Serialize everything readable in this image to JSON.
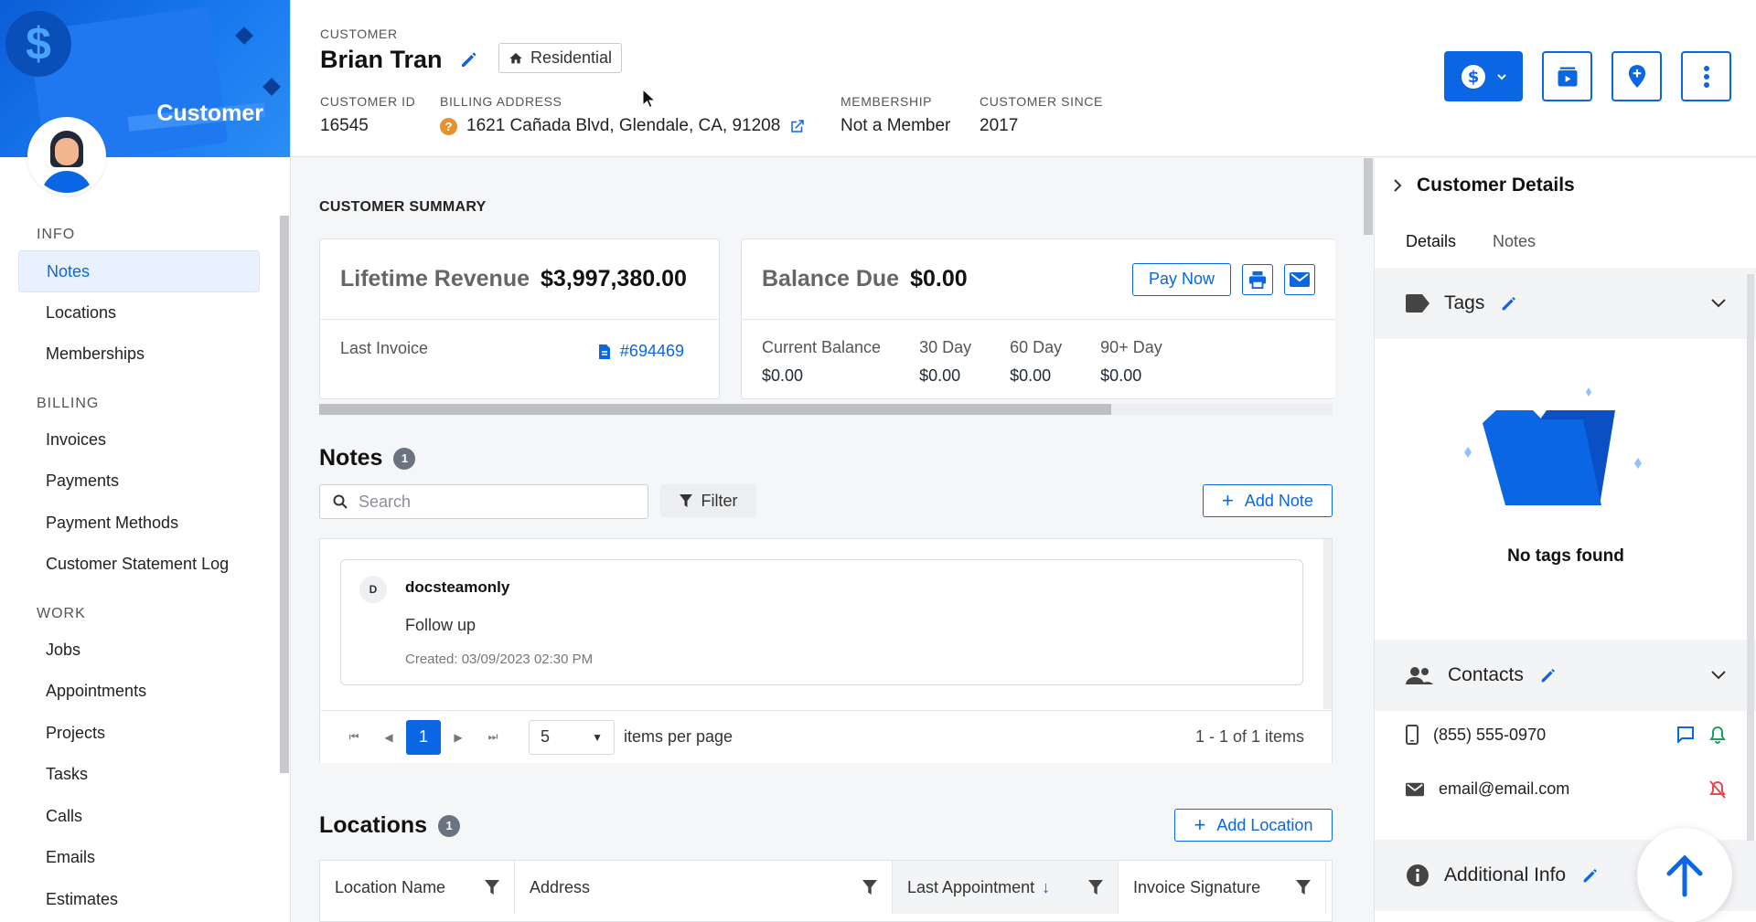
{
  "sidebar": {
    "banner_title": "Customer",
    "sections": [
      {
        "title": "INFO",
        "items": [
          "Notes",
          "Locations",
          "Memberships"
        ]
      },
      {
        "title": "BILLING",
        "items": [
          "Invoices",
          "Payments",
          "Payment Methods",
          "Customer Statement Log"
        ]
      },
      {
        "title": "WORK",
        "items": [
          "Jobs",
          "Appointments",
          "Projects",
          "Tasks",
          "Calls",
          "Emails",
          "Estimates"
        ]
      }
    ],
    "active_item": "Notes"
  },
  "header": {
    "customer_label": "CUSTOMER",
    "name": "Brian Tran",
    "type_badge": "Residential",
    "fields": {
      "id_label": "CUSTOMER ID",
      "id": "16545",
      "billing_label": "BILLING ADDRESS",
      "billing": "1621 Cañada Blvd, Glendale, CA, 91208",
      "membership_label": "MEMBERSHIP",
      "membership": "Not a Member",
      "since_label": "CUSTOMER SINCE",
      "since": "2017"
    }
  },
  "summary": {
    "label": "CUSTOMER SUMMARY",
    "lifetime_label": "Lifetime Revenue",
    "lifetime_value": "$3,997,380.00",
    "last_invoice_label": "Last Invoice",
    "last_invoice": "#694469",
    "balance_label": "Balance Due",
    "balance_value": "$0.00",
    "pay_now": "Pay Now",
    "aging": [
      {
        "label": "Current Balance",
        "value": "$0.00"
      },
      {
        "label": "30 Day",
        "value": "$0.00"
      },
      {
        "label": "60 Day",
        "value": "$0.00"
      },
      {
        "label": "90+ Day",
        "value": "$0.00"
      }
    ]
  },
  "notes": {
    "title": "Notes",
    "count": "1",
    "search_placeholder": "Search",
    "filter": "Filter",
    "add_label": "Add Note",
    "items": [
      {
        "initial": "D",
        "author": "docsteamonly",
        "text": "Follow up",
        "created": "Created: 03/09/2023 02:30 PM"
      }
    ],
    "pager": {
      "page": "1",
      "per_page": "5",
      "per_page_label": "items per page",
      "summary": "1 - 1 of 1 items"
    }
  },
  "locations": {
    "title": "Locations",
    "count": "1",
    "add_label": "Add Location",
    "columns": [
      "Location Name",
      "Address",
      "Last Appointment",
      "Invoice Signature"
    ]
  },
  "right_panel": {
    "title": "Customer Details",
    "tabs": [
      "Details",
      "Notes"
    ],
    "tags_title": "Tags",
    "no_tags": "No tags found",
    "contacts_title": "Contacts",
    "phone": "(855) 555-0970",
    "email": "email@email.com",
    "additional_title": "Additional Info"
  },
  "colors": {
    "primary": "#0b66e4",
    "warning": "#e8912d",
    "success": "#1aa260",
    "danger": "#e5484d"
  }
}
